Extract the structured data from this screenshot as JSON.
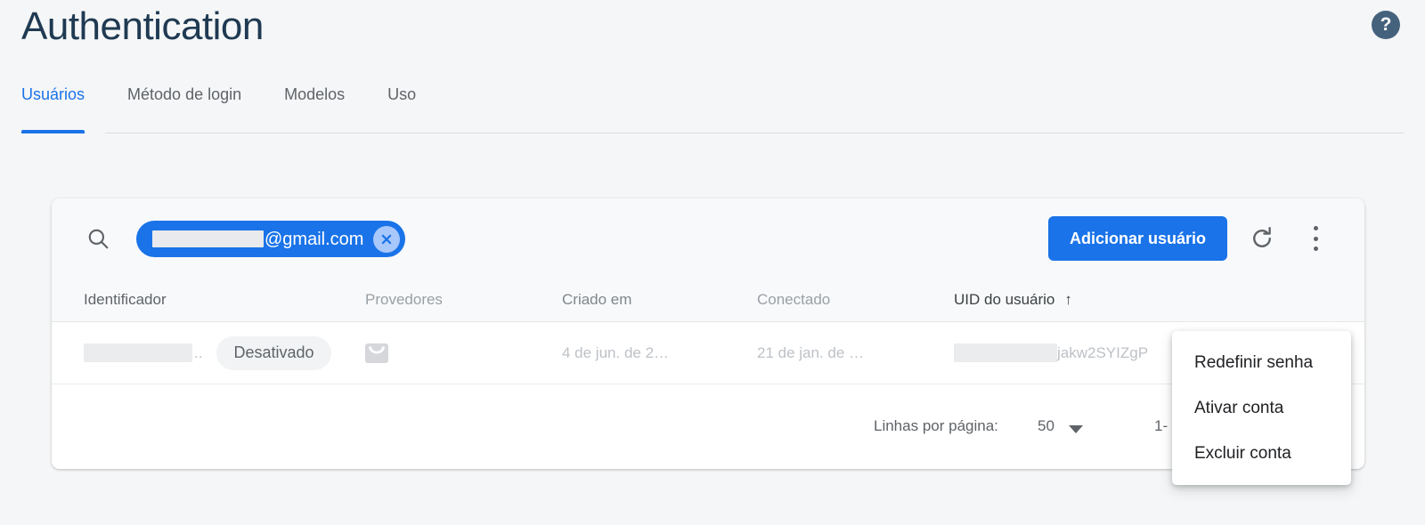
{
  "header": {
    "title": "Authentication",
    "help_icon": "help-circle-icon"
  },
  "tabs": [
    {
      "label": "Usuários",
      "active": true
    },
    {
      "label": "Método de login",
      "active": false
    },
    {
      "label": "Modelos",
      "active": false
    },
    {
      "label": "Uso",
      "active": false
    }
  ],
  "toolbar": {
    "search_icon": "search-icon",
    "search_chip": {
      "text": "@gmail.com",
      "redacted": true,
      "close_icon": "close-circle-icon"
    },
    "add_user_label": "Adicionar usuário",
    "refresh_icon": "refresh-icon",
    "overflow_icon": "more-vert-icon"
  },
  "table": {
    "columns": [
      {
        "label": "Identificador",
        "sorted": false
      },
      {
        "label": "Provedores",
        "sorted": false
      },
      {
        "label": "Criado em",
        "sorted": false
      },
      {
        "label": "Conectado",
        "sorted": false
      },
      {
        "label": "UID do usuário",
        "sorted": true,
        "sort_arrow": "↑"
      }
    ],
    "rows": [
      {
        "identifier_redacted": true,
        "identifier_ellipsis": "..",
        "status_badge": "Desativado",
        "provider_icon": "email-envelope-icon",
        "created": "4 de jun. de 2…",
        "signed_in": "21 de jan. de …",
        "uid_redacted": true,
        "uid": "jakw2SYIZgP"
      }
    ]
  },
  "footer": {
    "rows_per_page_label": "Linhas por página:",
    "rows_per_page_value": "50",
    "caret_icon": "chevron-down-icon",
    "range": "1-"
  },
  "context_menu": {
    "items": [
      {
        "label": "Redefinir senha"
      },
      {
        "label": "Ativar conta"
      },
      {
        "label": "Excluir conta"
      }
    ]
  },
  "colors": {
    "accent": "#1a73e8",
    "page_background": "#f5f6f7",
    "title": "#1f3a52",
    "muted_text": "#9aa0a6",
    "help_button": "#45627d",
    "chip_close": "#a8c7fa"
  }
}
